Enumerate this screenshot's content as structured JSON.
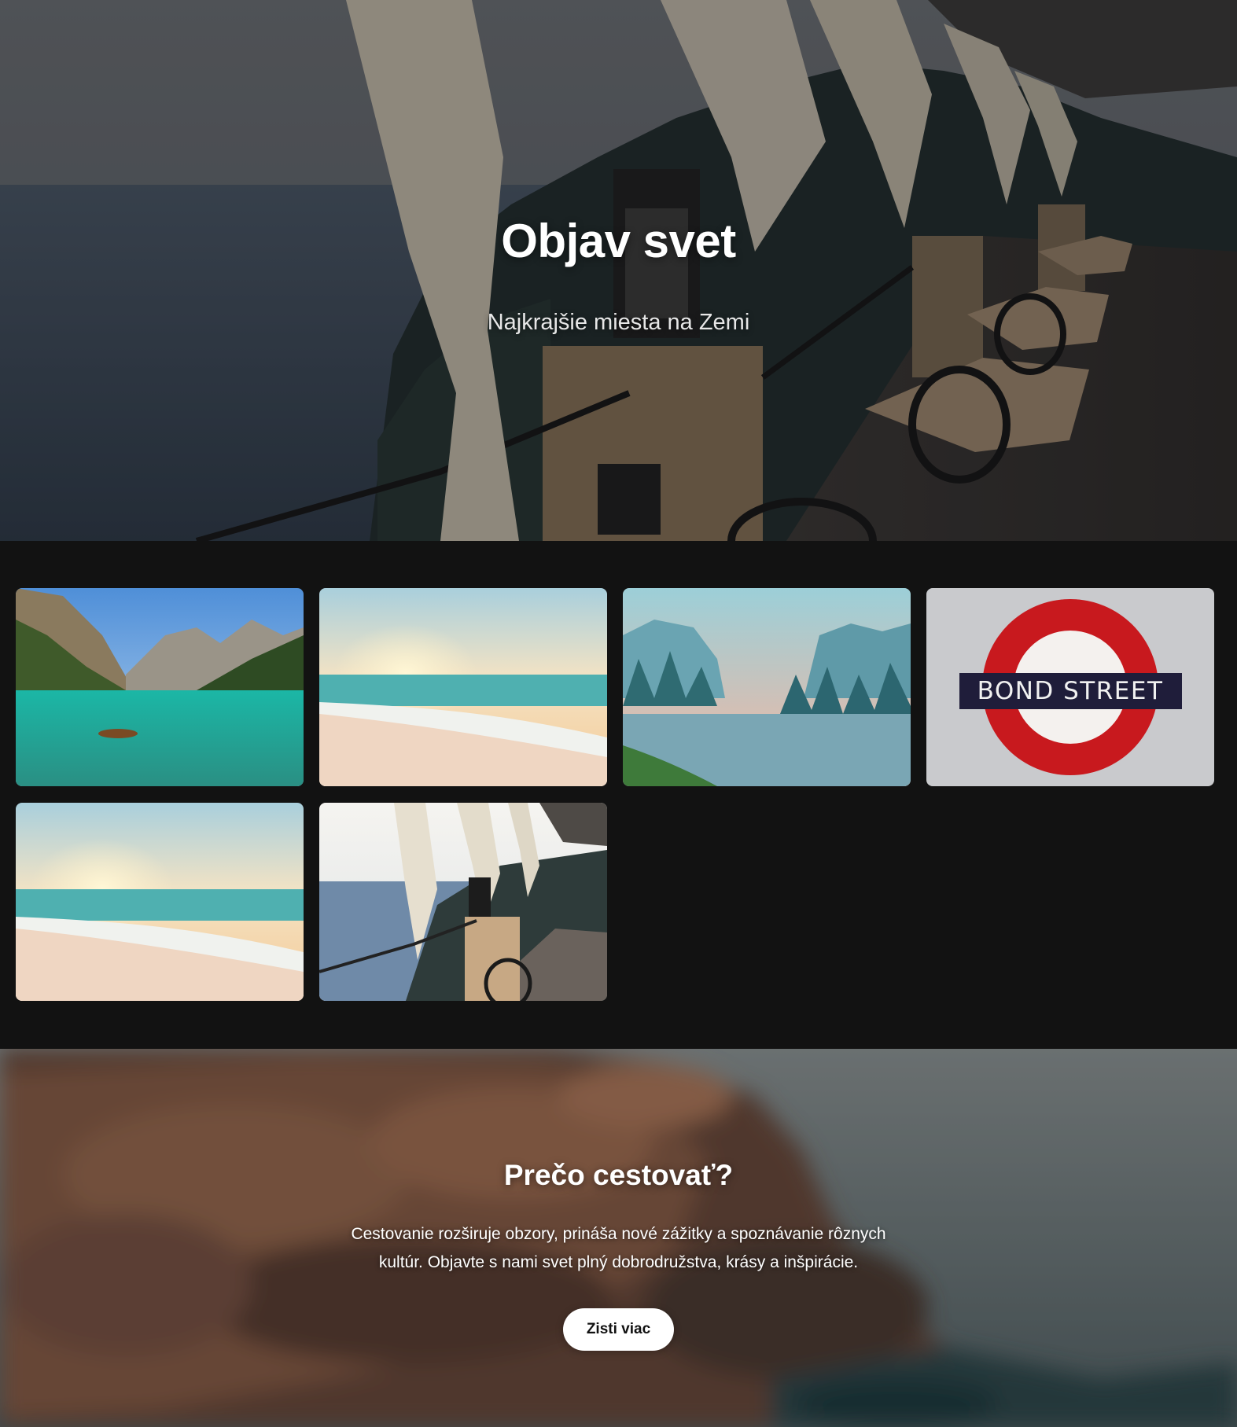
{
  "hero": {
    "title": "Objav svet",
    "subtitle": "Najkrajšie miesta na Zemi"
  },
  "gallery": {
    "tiles": [
      {
        "name": "mountain-lake-photo",
        "label": ""
      },
      {
        "name": "beach-sunset-photo",
        "label": ""
      },
      {
        "name": "valley-river-photo",
        "label": ""
      },
      {
        "name": "bond-street-sign-photo",
        "label": "BOND STREET"
      },
      {
        "name": "beach-sunset-photo-2",
        "label": ""
      },
      {
        "name": "terrace-sea-view-photo",
        "label": ""
      }
    ]
  },
  "why": {
    "title": "Prečo cestovať?",
    "text": "Cestovanie rozširuje obzory, prináša nové zážitky a spoznávanie rôznych kultúr. Objavte s nami svet plný dobrodružstva, krásy a inšpirácie.",
    "button_label": "Zisti viac"
  },
  "colors": {
    "page_background": "#121212",
    "button_background": "#ffffff",
    "sign_red": "#c8191e",
    "sign_blue": "#1f1d3a"
  }
}
